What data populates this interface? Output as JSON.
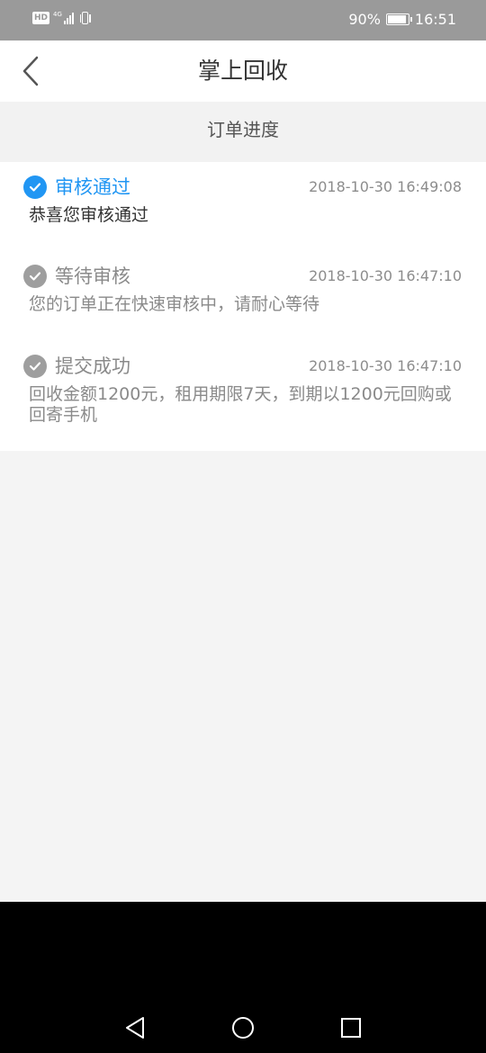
{
  "status_bar": {
    "network_badge": "HD",
    "network_type": "4G",
    "battery_text": "90%",
    "battery_level": 0.9,
    "time": "16:51"
  },
  "header": {
    "title": "掌上回收",
    "back_icon": "chevron-left-icon"
  },
  "section": {
    "title": "订单进度"
  },
  "timeline": [
    {
      "status": "审核通过",
      "time": "2018-10-30 16:49:08",
      "description": "恭喜您审核通过",
      "active": true
    },
    {
      "status": "等待审核",
      "time": "2018-10-30 16:47:10",
      "description": "您的订单正在快速审核中，请耐心等待",
      "active": false
    },
    {
      "status": "提交成功",
      "time": "2018-10-30 16:47:10",
      "description": "回收金额1200元，租用期限7天，到期以1200元回购或回寄手机",
      "active": false
    }
  ],
  "colors": {
    "active": "#2196f3",
    "inactive_icon": "#9e9e9e",
    "inactive_text": "#8a8a8a",
    "active_desc": "#333333",
    "status_bar": "#9a9a9a"
  },
  "system_nav": {
    "back_icon": "triangle-back-icon",
    "home_icon": "circle-home-icon",
    "recents_icon": "square-recents-icon"
  }
}
